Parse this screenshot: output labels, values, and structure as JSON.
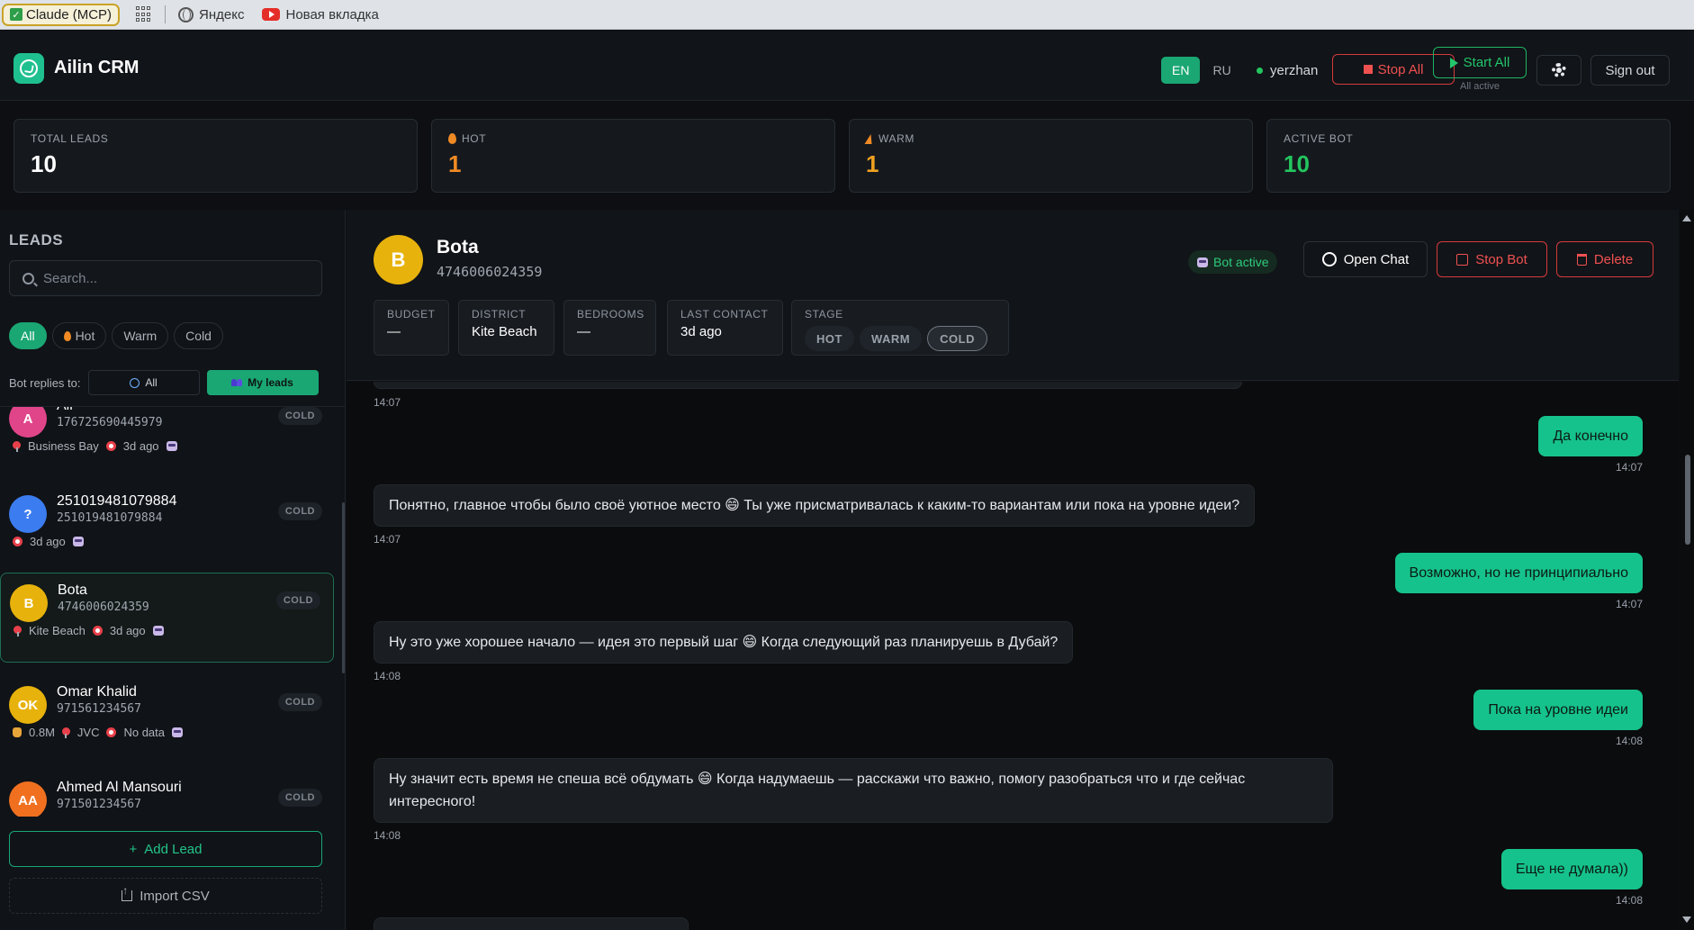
{
  "browser": {
    "bookmarks": [
      {
        "label": "Claude (MCP)",
        "icon": "check-icon"
      },
      {
        "label": "Яндекс",
        "icon": "globe-icon"
      },
      {
        "label": "Новая вкладка",
        "icon": "youtube-icon"
      }
    ]
  },
  "header": {
    "app_title": "Ailin CRM",
    "lang_en": "EN",
    "lang_ru": "RU",
    "user": "yerzhan",
    "stop_all": "Stop All",
    "start_all": "Start All",
    "start_sub": "All active",
    "sign_out": "Sign out"
  },
  "stats": [
    {
      "label": "TOTAL LEADS",
      "value": "10",
      "color": "#ffffff"
    },
    {
      "label": "HOT",
      "value": "1",
      "color": "#f08a24"
    },
    {
      "label": "WARM",
      "value": "1",
      "color": "#f0a020"
    },
    {
      "label": "ACTIVE BOT",
      "value": "10",
      "color": "#23c55e"
    }
  ],
  "sidebar": {
    "title": "LEADS",
    "search_placeholder": "Search...",
    "filters": [
      "All",
      "Hot",
      "Warm",
      "Cold"
    ],
    "replies_label": "Bot replies to:",
    "reply_all": "All",
    "reply_mine": "My leads",
    "add_lead": "Add Lead",
    "import_csv": "Import CSV",
    "leads": [
      {
        "initials": "A",
        "name": "Ali",
        "phone": "176725690445979",
        "stage": "COLD",
        "avatar_color": "#e0458a",
        "district": "Business Bay",
        "last": "3d ago",
        "budget": ""
      },
      {
        "initials": "?",
        "name": "251019481079884",
        "phone": "251019481079884",
        "stage": "COLD",
        "avatar_color": "#3b7cf0",
        "district": "",
        "last": "3d ago",
        "budget": ""
      },
      {
        "initials": "B",
        "name": "Bota",
        "phone": "4746006024359",
        "stage": "COLD",
        "avatar_color": "#e7b20c",
        "district": "Kite Beach",
        "last": "3d ago",
        "budget": ""
      },
      {
        "initials": "OK",
        "name": "Omar Khalid",
        "phone": "971561234567",
        "stage": "COLD",
        "avatar_color": "#e7b20c",
        "district": "JVC",
        "last": "No data",
        "budget": "0.8M"
      },
      {
        "initials": "AA",
        "name": "Ahmed Al Mansouri",
        "phone": "971501234567",
        "stage": "COLD",
        "avatar_color": "#f07020",
        "district": "",
        "last": "",
        "budget": ""
      }
    ]
  },
  "detail": {
    "initials": "B",
    "name": "Bota",
    "phone": "4746006024359",
    "bot_status": "Bot active",
    "open_chat": "Open Chat",
    "stop_bot": "Stop Bot",
    "delete": "Delete",
    "fields": [
      {
        "label": "BUDGET",
        "value": "—"
      },
      {
        "label": "DISTRICT",
        "value": "Kite Beach"
      },
      {
        "label": "BEDROOMS",
        "value": "—"
      },
      {
        "label": "LAST CONTACT",
        "value": "3d ago"
      }
    ],
    "stage_label": "STAGE",
    "stages": [
      "HOT",
      "WARM",
      "COLD"
    ],
    "active_stage": "COLD"
  },
  "chat": {
    "messages": [
      {
        "dir": "in",
        "text": "",
        "time": "14:07"
      },
      {
        "dir": "out",
        "text": "Да конечно",
        "time": "14:07"
      },
      {
        "dir": "in",
        "text": "Понятно, главное чтобы было своё уютное место 😄 Ты уже присматривалась к каким-то вариантам или пока на уровне идеи?",
        "time": "14:07"
      },
      {
        "dir": "out",
        "text": "Возможно, но не принципиально",
        "time": "14:07"
      },
      {
        "dir": "in",
        "text": "Ну это уже хорошее начало — идея это первый шаг 😄 Когда следующий раз планируешь в Дубай?",
        "time": "14:08"
      },
      {
        "dir": "out",
        "text": "Пока на уровне идеи",
        "time": "14:08"
      },
      {
        "dir": "in",
        "text": "Ну значит есть время не спеша всё обдумать 😄 Когда надумаешь — расскажи что важно, помогу разобраться что и где сейчас интересного!",
        "time": "14:08"
      },
      {
        "dir": "out",
        "text": "Еще не думала))",
        "time": "14:08"
      }
    ]
  }
}
